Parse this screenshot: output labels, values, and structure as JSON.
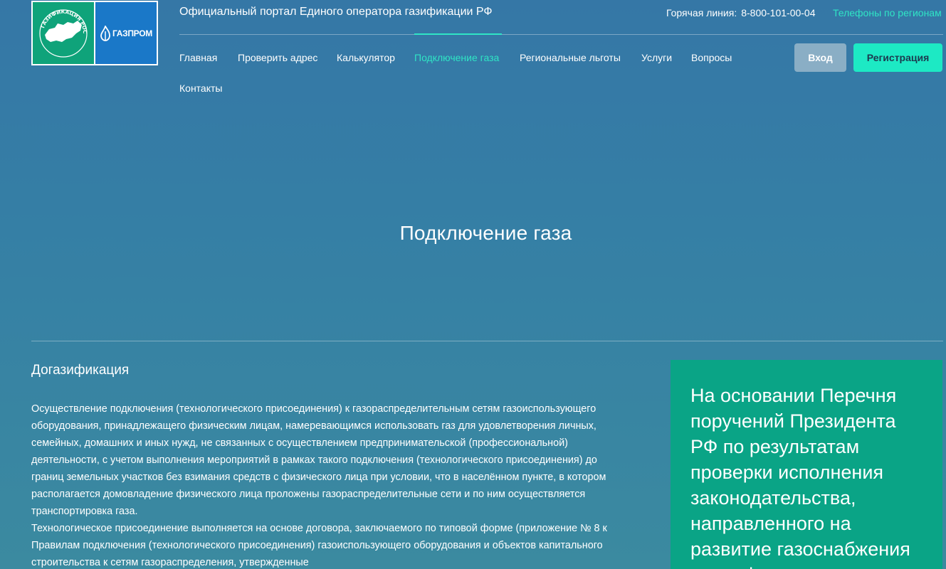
{
  "logo": {
    "left_text": "ГАЗИФИКАЦИЯ РОССИИ",
    "right_text": "ГАЗПРОМ",
    "colors": {
      "green": "#0fa37a",
      "blue": "#1a78c8"
    }
  },
  "header": {
    "portal_title": "Официальный портал Единого оператора газификации РФ",
    "hotline_label": "Горячая линия:",
    "hotline_number": "8-800-101-00-04",
    "regions_link": "Телефоны по регионам"
  },
  "nav": {
    "items": [
      {
        "label": "Главная"
      },
      {
        "label": "Проверить адрес"
      },
      {
        "label": "Калькулятор"
      },
      {
        "label": "Подключение газа",
        "active": true
      },
      {
        "label": "Региональные льготы"
      },
      {
        "label": "Услуги"
      },
      {
        "label": "Вопросы"
      },
      {
        "label": "Контакты"
      }
    ]
  },
  "auth": {
    "login_label": "Вход",
    "register_label": "Регистрация"
  },
  "hero": {
    "title": "Подключение газа"
  },
  "content": {
    "heading": "Догазификация",
    "paragraph_1": "Осуществление подключения (технологического присоединения) к газораспределительным сетям газоиспользующего оборудования, принадлежащего физическим лицам, намеревающимся использовать газ для удовлетворения личных, семейных, домашних и иных нужд, не связанных с осуществлением предпринимательской (профессиональной) деятельности, с учетом выполнения мероприятий в рамках такого подключения (технологического присоединения) до границ земельных участков без взимания средств с физического лица при условии, что в населённом пункте, в котором располагается домовладение физического лица проложены газораспределительные сети и по ним осуществляется транспортировка газа.",
    "paragraph_2": "Технологическое присоединение выполняется на основе договора, заключаемого по типовой форме (приложение № 8 к Правилам подключения (технологического присоединения) газоиспользующего оборудования и объектов капитального строительства к сетям газораспределения, утвержденные"
  },
  "card": {
    "text": "На основании Перечня поручений Президента РФ по результатам проверки исполнения законодательства, направленного на развитие газоснабжения и газификации"
  },
  "colors": {
    "accent": "#2fe5c5",
    "card_bg": "#0aa486",
    "register_bg": "#1de9c4",
    "login_bg": "#8aaec5"
  }
}
